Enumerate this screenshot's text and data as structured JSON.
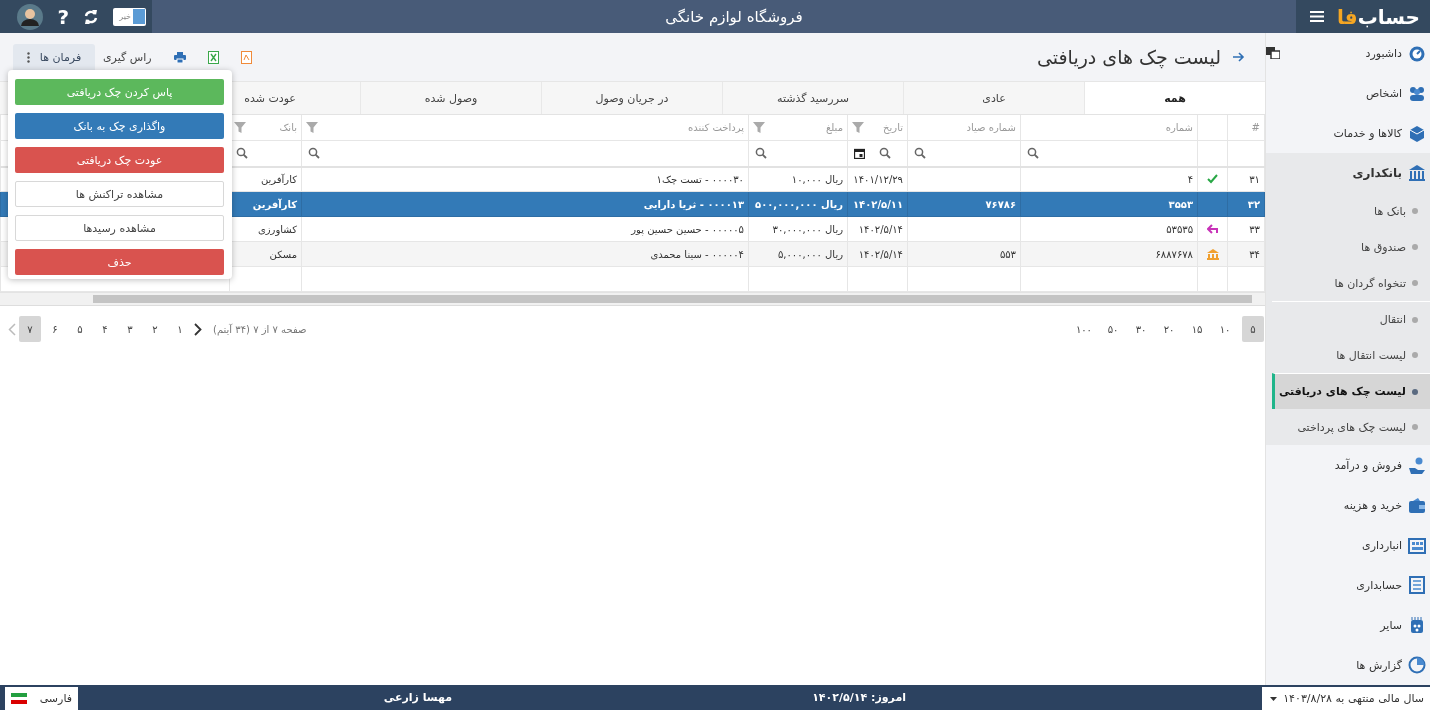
{
  "top_bar": {
    "logo": [
      "حساب",
      "فا"
    ],
    "title": "فروشگاه لوازم خانگی",
    "toggle_label": "خیر",
    "help_label": "?"
  },
  "sidebar": {
    "items": [
      {
        "label": "داشبورد",
        "expanded": false
      },
      {
        "label": "اشخاص",
        "expanded": false
      },
      {
        "label": "کالاها و خدمات",
        "expanded": false
      },
      {
        "label": "بانکداری",
        "expanded": true,
        "children": [
          {
            "label": "بانک ها",
            "selected": false,
            "divider_before": false
          },
          {
            "label": "صندوق ها",
            "selected": false,
            "divider_before": false
          },
          {
            "label": "تنخواه گردان ها",
            "selected": false,
            "divider_before": false
          },
          {
            "label": "انتقال",
            "selected": false,
            "divider_before": true
          },
          {
            "label": "لیست انتقال ها",
            "selected": false,
            "divider_before": false
          },
          {
            "label": "لیست چک های دریافتی",
            "selected": true,
            "divider_before": true
          },
          {
            "label": "لیست چک های پرداختی",
            "selected": false,
            "divider_before": false
          }
        ]
      },
      {
        "label": "فروش و درآمد",
        "expanded": false
      },
      {
        "label": "خرید و هزینه",
        "expanded": false
      },
      {
        "label": "انبارداری",
        "expanded": false
      },
      {
        "label": "حسابداری",
        "expanded": false
      },
      {
        "label": "سایر",
        "expanded": false
      },
      {
        "label": "گزارش ها",
        "expanded": false
      }
    ]
  },
  "page": {
    "title": "لیست چک های دریافتی",
    "toolbar": [
      {
        "kind": "pdf"
      },
      {
        "kind": "excel"
      },
      {
        "kind": "print"
      },
      {
        "kind": "text",
        "label": "راس گیری"
      }
    ],
    "commands": {
      "label": "فرمان ها",
      "open": true,
      "items": [
        {
          "label": "پاس کردن چک دریافتی",
          "kind": "success"
        },
        {
          "label": "واگذاری چک به بانک",
          "kind": "primary"
        },
        {
          "label": "عودت چک دریافتی",
          "kind": "danger"
        },
        {
          "label": "مشاهده تراکنش ها",
          "kind": "default"
        },
        {
          "label": "مشاهده رسیدها",
          "kind": "default"
        },
        {
          "label": "حذف",
          "kind": "danger"
        }
      ]
    }
  },
  "tabs": [
    {
      "label": "همه",
      "selected": true
    },
    {
      "label": "عادی",
      "selected": false
    },
    {
      "label": "سررسید گذشته",
      "selected": false
    },
    {
      "label": "در جریان وصول",
      "selected": false
    },
    {
      "label": "وصول شده",
      "selected": false
    },
    {
      "label": "عودت شده",
      "selected": false
    }
  ],
  "table": {
    "columns": [
      {
        "label": "#",
        "kind": "index",
        "filter": false,
        "search": false
      },
      {
        "kind": "status",
        "filter": false,
        "search": false
      },
      {
        "label": "شماره",
        "kind": "text",
        "filter": false,
        "search": true
      },
      {
        "label": "شماره صیاد",
        "kind": "text",
        "filter": false,
        "search": true
      },
      {
        "label": "تاریخ",
        "kind": "date",
        "filter": true,
        "search": true
      },
      {
        "label": "مبلغ",
        "kind": "text",
        "filter": true,
        "search": true
      },
      {
        "label": "پرداخت کننده",
        "kind": "text",
        "filter": true,
        "search": true
      },
      {
        "label": "بانک",
        "kind": "text",
        "filter": true,
        "search": true
      }
    ],
    "rows": [
      {
        "selected": false,
        "kind": "cleared",
        "cells": [
          "۳۱",
          null,
          "۴",
          null,
          "۱۴۰۱/۱۲/۲۹",
          "ریال ۱۰,۰۰۰",
          "۰۰۰۰۳۰ - تست چک۱",
          "کارآفرین"
        ]
      },
      {
        "selected": true,
        "kind": "plain",
        "cells": [
          "۳۲",
          null,
          "۳۵۵۳",
          "۷۶۷۸۶",
          "۱۴۰۲/۵/۱۱",
          "ریال ۵۰۰,۰۰۰,۰۰۰",
          "۰۰۰۰۱۳ - ثریا دارایی",
          "کارآفرین"
        ]
      },
      {
        "selected": false,
        "kind": "returned",
        "cells": [
          "۳۳",
          null,
          "۵۳۵۳۵",
          null,
          "۱۴۰۲/۵/۱۴",
          "ریال ۳۰,۰۰۰,۰۰۰",
          "۰۰۰۰۰۵ - حسین حسین پور",
          "کشاورزی"
        ]
      },
      {
        "selected": false,
        "kind": "deposited",
        "cells": [
          "۳۴",
          null,
          "۶۸۸۷۶۷۸",
          "۵۵۳",
          "۱۴۰۲/۵/۱۴",
          "ریال ۵,۰۰۰,۰۰۰",
          "۰۰۰۰۰۴ - سینا محمدی",
          "مسکن"
        ]
      }
    ]
  },
  "pager": {
    "page_sizes": [
      {
        "label": "۵",
        "selected": true
      },
      {
        "label": "۱۰",
        "selected": false
      },
      {
        "label": "۱۵",
        "selected": false
      },
      {
        "label": "۲۰",
        "selected": false
      },
      {
        "label": "۳۰",
        "selected": false
      },
      {
        "label": "۵۰",
        "selected": false
      },
      {
        "label": "۱۰۰",
        "selected": false
      }
    ],
    "summary": "صفحه ۷ از ۷ (۳۴ آیتم)",
    "pages": [
      {
        "label": "۱",
        "selected": false
      },
      {
        "label": "۲",
        "selected": false
      },
      {
        "label": "۳",
        "selected": false
      },
      {
        "label": "۴",
        "selected": false
      },
      {
        "label": "۵",
        "selected": false
      },
      {
        "label": "۶",
        "selected": false
      },
      {
        "label": "۷",
        "selected": true
      }
    ]
  },
  "status_bar": {
    "fiscal_year": "سال مالی منتهی به ۱۴۰۳/۸/۲۸",
    "today": "امروز: ۱۴۰۲/۵/۱۴",
    "user": "مهسا زارعی",
    "language": "فارسی"
  }
}
